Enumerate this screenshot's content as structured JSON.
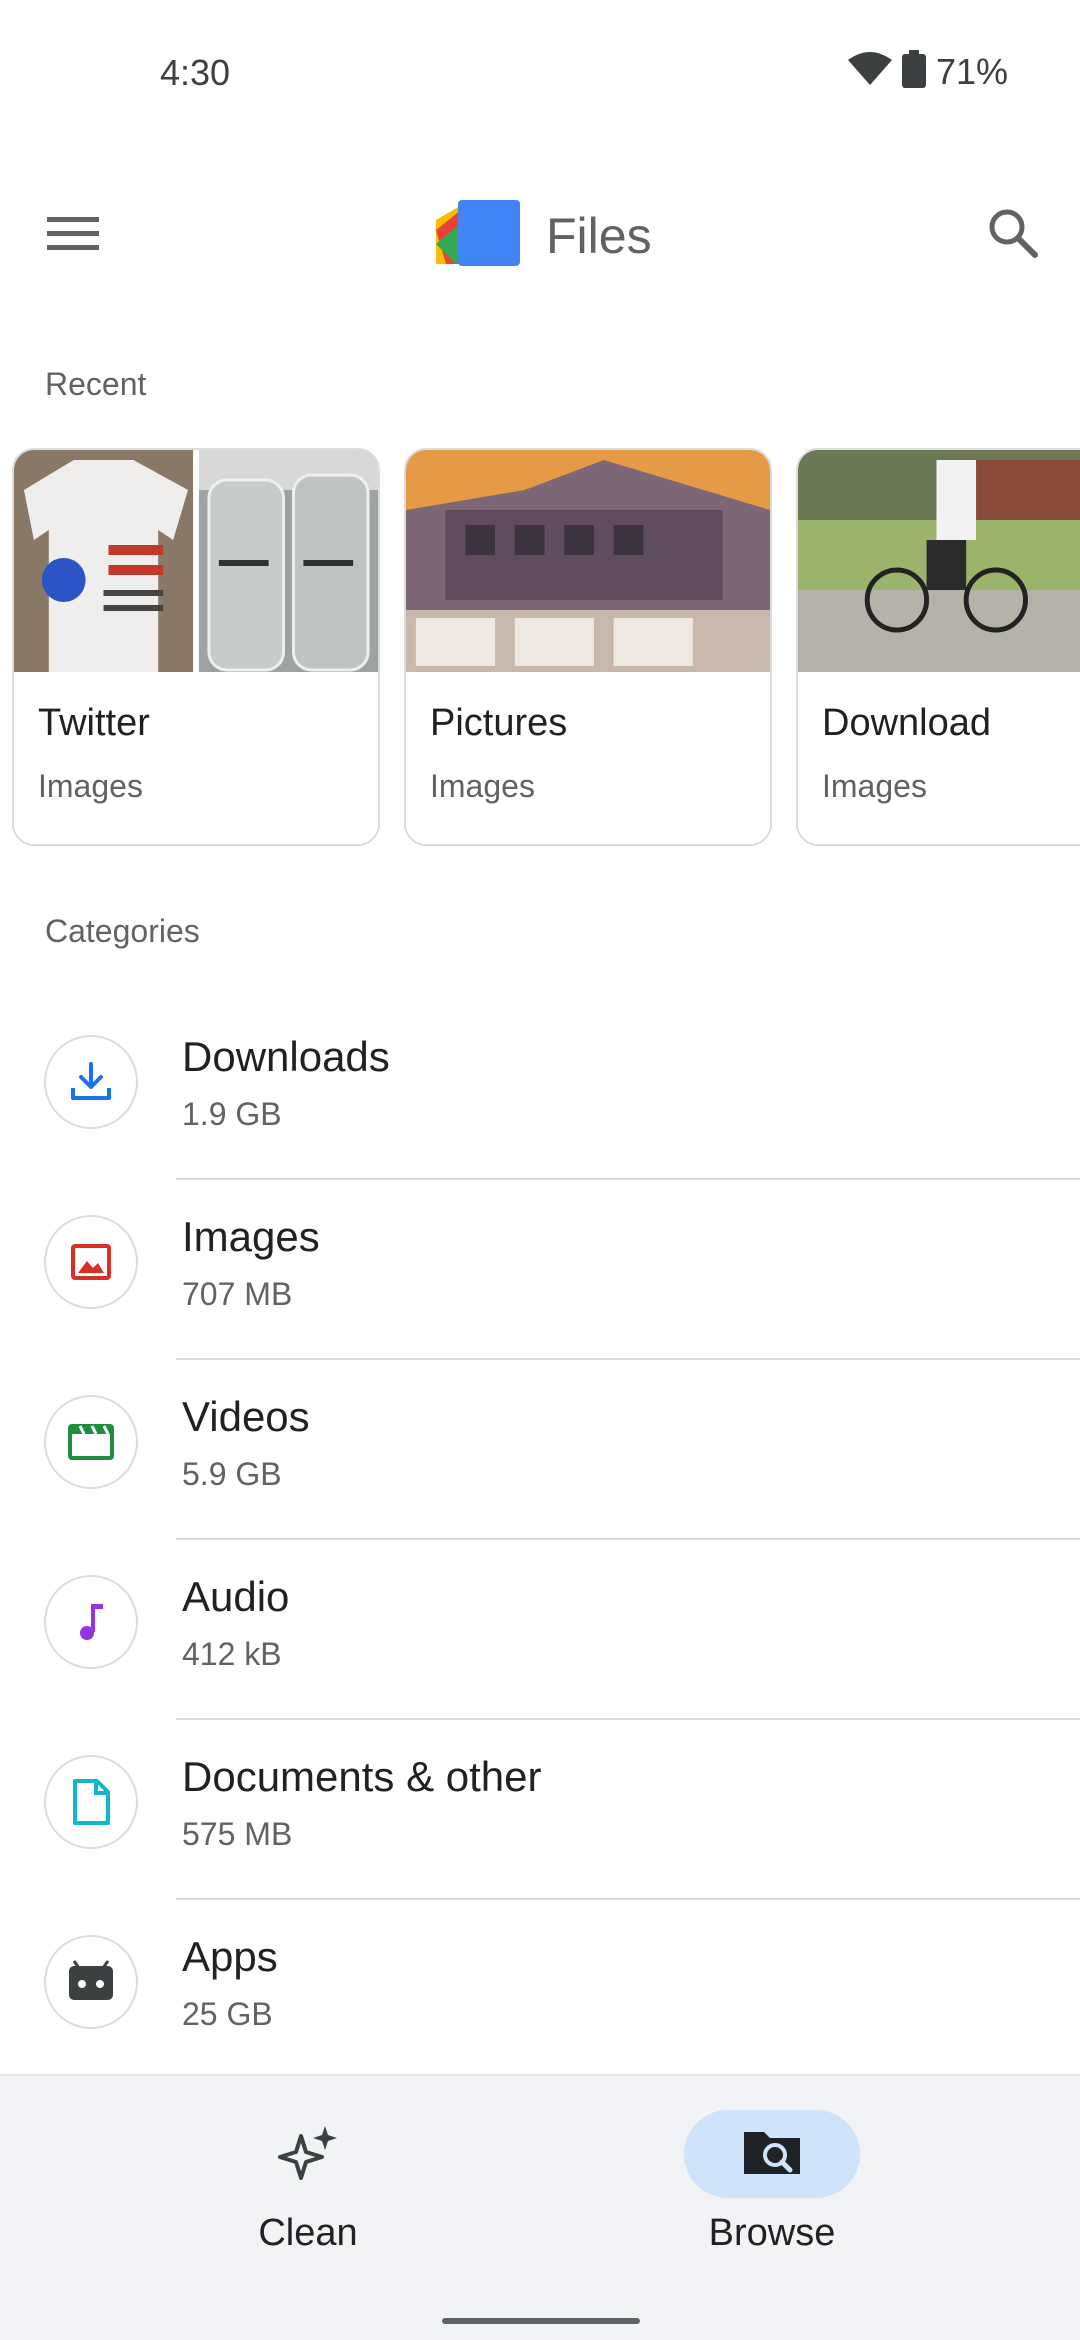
{
  "status_bar": {
    "time": "4:30",
    "battery": "71%",
    "icons": [
      "wifi-icon",
      "battery-icon"
    ]
  },
  "app_bar": {
    "title": "Files",
    "menu_icon": "hamburger-menu-icon",
    "search_icon": "search-icon",
    "logo_colors": [
      "#4285f4",
      "#34a853",
      "#fbbc04",
      "#ea4335"
    ]
  },
  "recent": {
    "header": "Recent",
    "cards": [
      {
        "title": "Twitter",
        "subtitle": "Images"
      },
      {
        "title": "Pictures",
        "subtitle": "Images"
      },
      {
        "title": "Download",
        "subtitle": "Images"
      }
    ]
  },
  "categories": {
    "header": "Categories",
    "items": [
      {
        "name": "Downloads",
        "size": "1.9 GB",
        "icon": "download-icon",
        "color": "#1a73e8"
      },
      {
        "name": "Images",
        "size": "707 MB",
        "icon": "image-icon",
        "color": "#d93025"
      },
      {
        "name": "Videos",
        "size": "5.9 GB",
        "icon": "video-icon",
        "color": "#1e8e3e"
      },
      {
        "name": "Audio",
        "size": "412 kB",
        "icon": "music-note-icon",
        "color": "#9334e6"
      },
      {
        "name": "Documents & other",
        "size": "575 MB",
        "icon": "document-icon",
        "color": "#12b5cb"
      },
      {
        "name": "Apps",
        "size": "25 GB",
        "icon": "android-icon",
        "color": "#3c4043"
      }
    ]
  },
  "bottom_nav": {
    "items": [
      {
        "label": "Clean",
        "icon": "sparkle-icon",
        "active": false
      },
      {
        "label": "Browse",
        "icon": "browse-folder-icon",
        "active": true
      }
    ]
  }
}
